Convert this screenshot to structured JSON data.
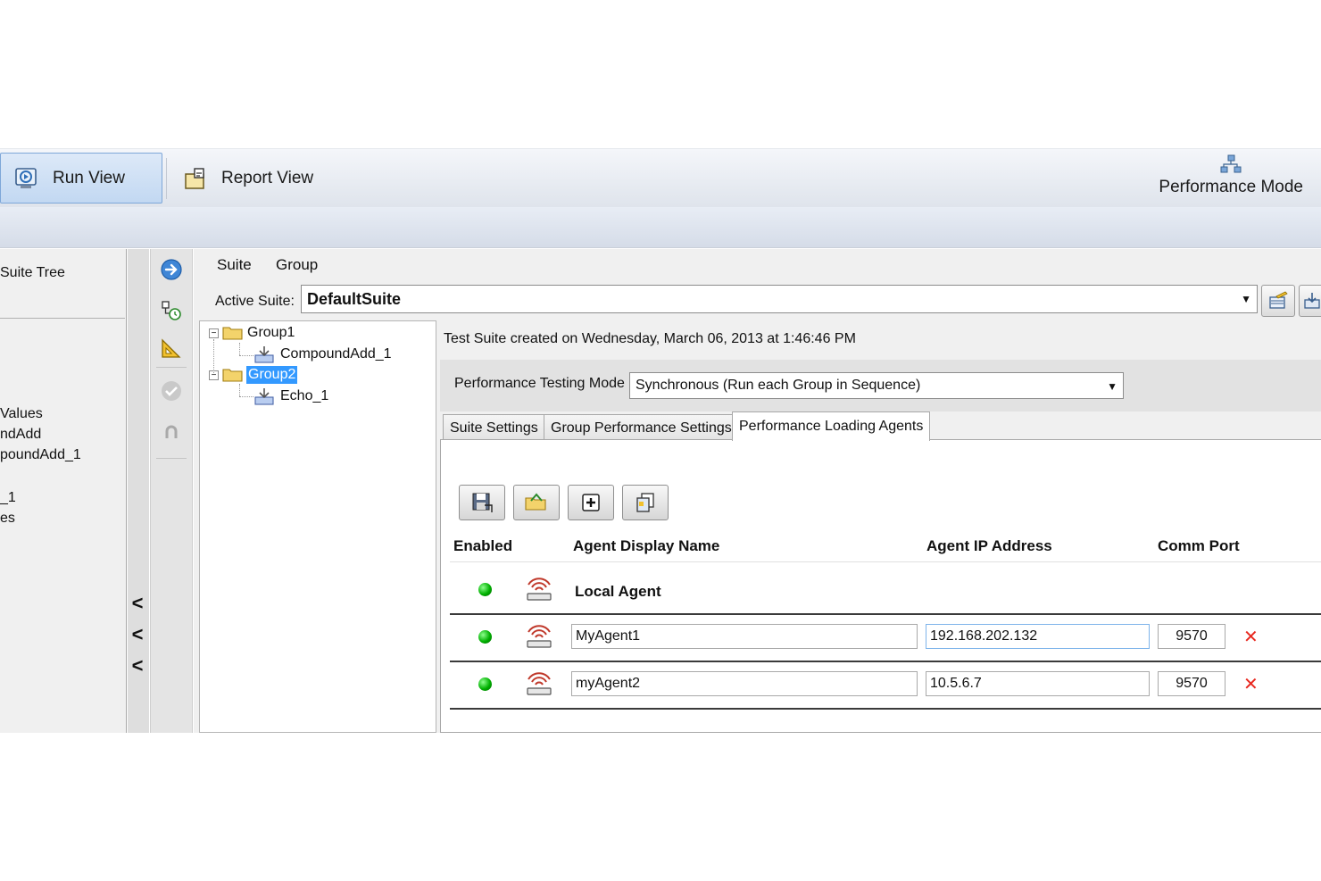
{
  "ribbon": {
    "run_view": "Run View",
    "report_view": "Report View",
    "performance_mode": "Performance Mode"
  },
  "left_panel": {
    "title": "Suite Tree",
    "items": [
      "Values",
      "ndAdd",
      "poundAdd_1",
      "_1",
      "es"
    ]
  },
  "collapse": [
    "<",
    "<",
    "<"
  ],
  "icon_strip": [
    "arrow-right-icon",
    "schedule-icon",
    "triangle-ruler-icon",
    "check-icon",
    "undo-icon"
  ],
  "menu": {
    "suite": "Suite",
    "group": "Group"
  },
  "active_suite": {
    "label": "Active Suite:",
    "value": "DefaultSuite"
  },
  "tree": {
    "nodes": [
      {
        "label": "Group1",
        "type": "group"
      },
      {
        "label": "CompoundAdd_1",
        "type": "test"
      },
      {
        "label": "Group2",
        "type": "group",
        "selected": true
      },
      {
        "label": "Echo_1",
        "type": "test"
      }
    ]
  },
  "info": {
    "created": "Test Suite created on Wednesday, March 06, 2013 at 1:46:46 PM"
  },
  "perf_mode": {
    "label": "Performance Testing Mode",
    "value": "Synchronous (Run each Group in Sequence)"
  },
  "tabs": [
    {
      "label": "Suite Settings",
      "active": false
    },
    {
      "label": "Group Performance Settings",
      "active": false
    },
    {
      "label": "Performance Loading Agents",
      "active": true
    }
  ],
  "agents_table": {
    "headers": {
      "enabled": "Enabled",
      "name": "Agent Display Name",
      "ip": "Agent IP Address",
      "port": "Comm Port"
    },
    "local_agent": "Local Agent",
    "rows": [
      {
        "name": "MyAgent1",
        "ip": "192.168.202.132",
        "port": "9570"
      },
      {
        "name": "myAgent2",
        "ip": "10.5.6.7",
        "port": "9570"
      }
    ],
    "delete_symbol": "✕"
  },
  "colors": {
    "selection": "#3399ff",
    "enabled": "#00b000",
    "delete": "#e8281f",
    "accent_border": "#7ea7d8"
  }
}
